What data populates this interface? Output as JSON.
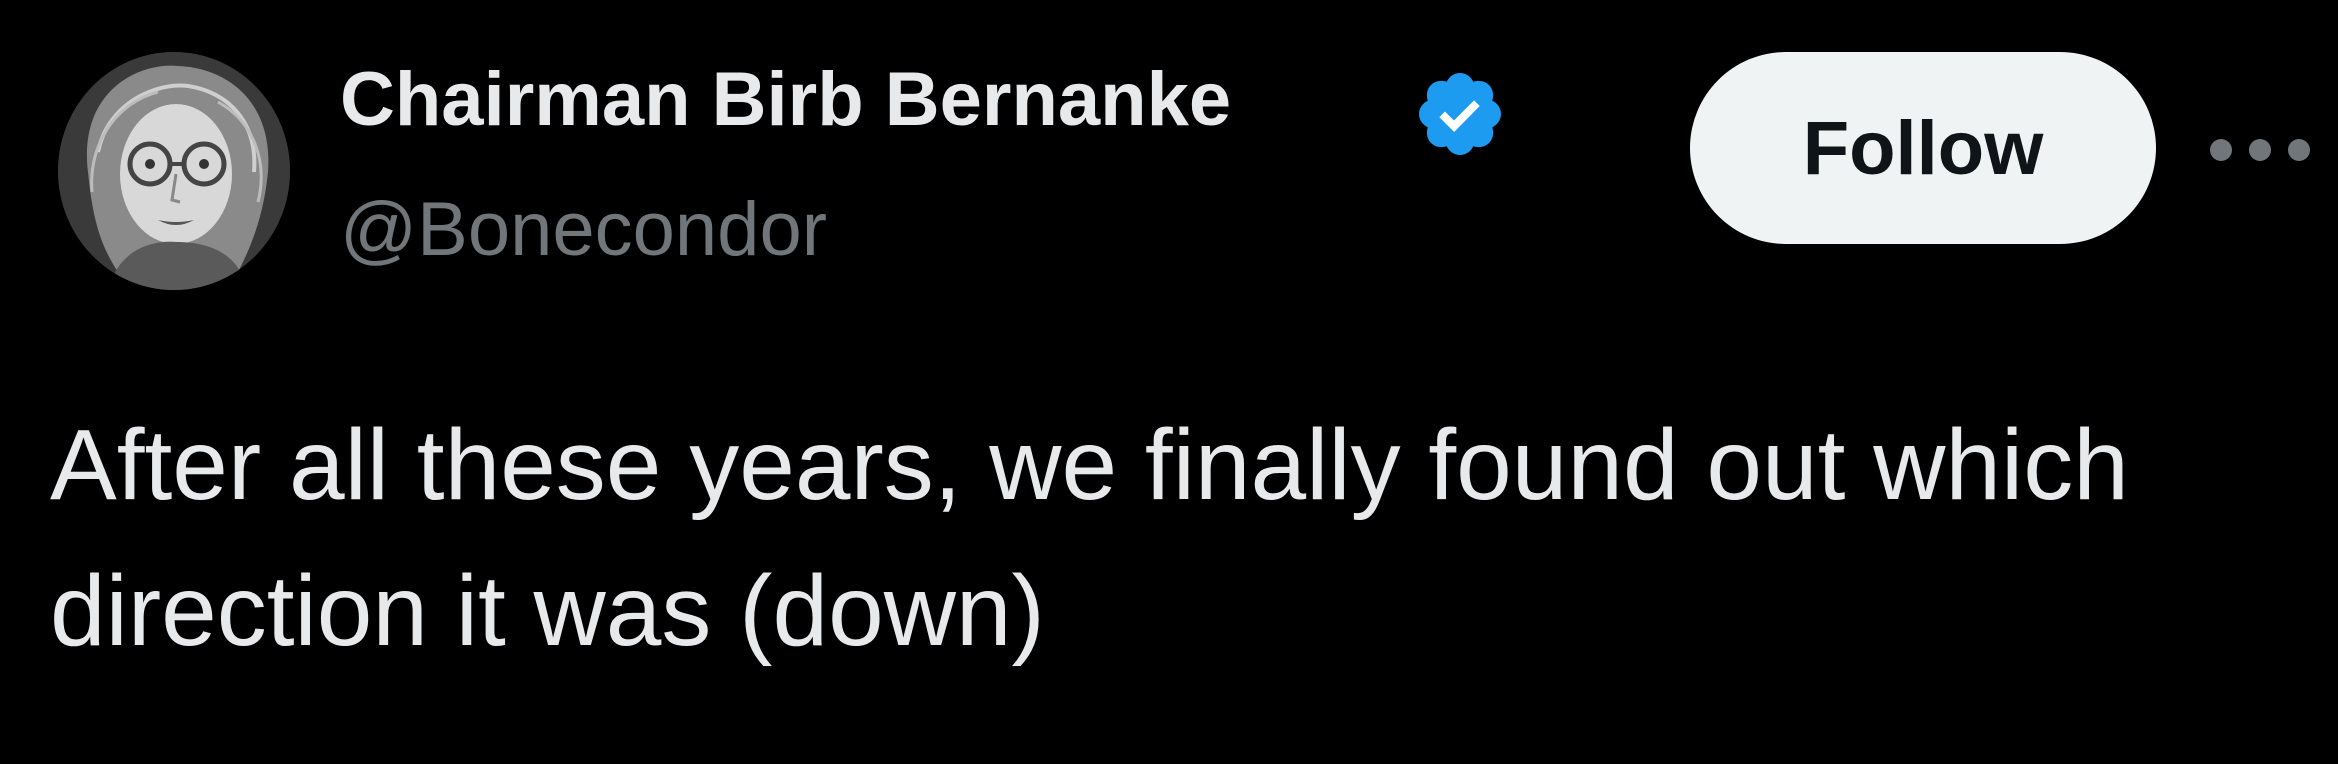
{
  "author": {
    "display_name": "Chairman Birb Bernanke",
    "handle": "@Bonecondor",
    "verified": true,
    "avatar_icon": "profile-avatar"
  },
  "actions": {
    "follow_label": "Follow",
    "more_icon": "more-options-icon"
  },
  "tweet": {
    "text": "After all these years, we finally found out which direction it was (down)"
  },
  "colors": {
    "background": "#000000",
    "primary_text": "#e7e9ea",
    "secondary_text": "#71767b",
    "verified_badge": "#1d9bf0",
    "follow_button_bg": "#eff3f4",
    "follow_button_text": "#0f1419"
  }
}
